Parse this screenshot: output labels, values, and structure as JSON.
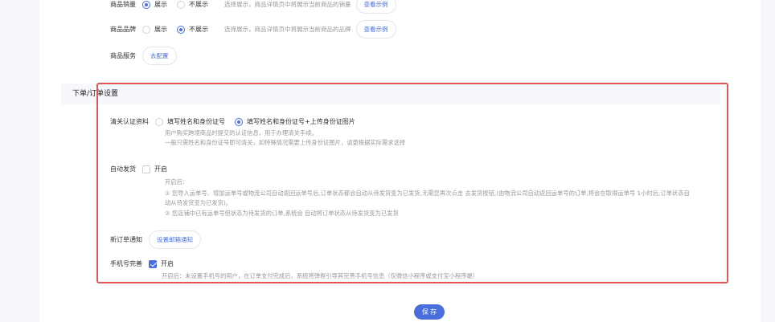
{
  "product": {
    "sales": {
      "label": "商品销量",
      "options": [
        "展示",
        "不展示"
      ],
      "selected": 0,
      "hint": "选择展示，商品详情页中将展示当前商品的销量",
      "example": "查看示例"
    },
    "brand": {
      "label": "商品品牌",
      "options": [
        "展示",
        "不展示"
      ],
      "selected": 1,
      "hint": "选择展示，商品详情页中将展示当前商品的品牌",
      "example": "查看示例"
    },
    "service": {
      "label": "商品服务",
      "button": "去配置"
    }
  },
  "order": {
    "title": "下单/订单设置",
    "customs": {
      "label": "清关认证资料",
      "options": [
        "填写姓名和身份证号",
        "填写姓名和身份证号+上传身份证图片"
      ],
      "selected": 1,
      "hints": [
        "用户购买跨境商品时提交的认证信息，用于办理清关手续。",
        "一般只需姓名和身份证号即可清关，如特殊情况需要上传身份证图片，请更根据实际需求选择"
      ]
    },
    "auto_ship": {
      "label": "自动发货",
      "checkbox": "开启",
      "checked": false,
      "hints": [
        "开启后：",
        "① 您导入运单号、增加运单号或物流公司自动返回运单号后,订单状态都会自动从待发货变为已发货,无需您再次点击 去发货按钮,(由物流公司自动返回运单号的订单,将会在取得运单号 1小时后,订单状态自",
        "动从待发货变为已发货)。",
        "② 您店铺中已有运单号但状态为待发货的订单,系统会 自动将订单状态从待发货变为已发货"
      ]
    },
    "new_order": {
      "label": "新订单通知",
      "button": "设置邮箱通知"
    },
    "phone": {
      "label": "手机号完善",
      "checkbox": "开启",
      "checked": true,
      "hint": "开启后：未设置手机号的用户，在订单支付完成后，系统将弹框引导其完善手机号信息（仅微信小程序或支付宝小程序端）"
    }
  },
  "save_label": "保 存",
  "colors": {
    "accent": "#4a6fdc",
    "highlight": "#e0555a"
  }
}
